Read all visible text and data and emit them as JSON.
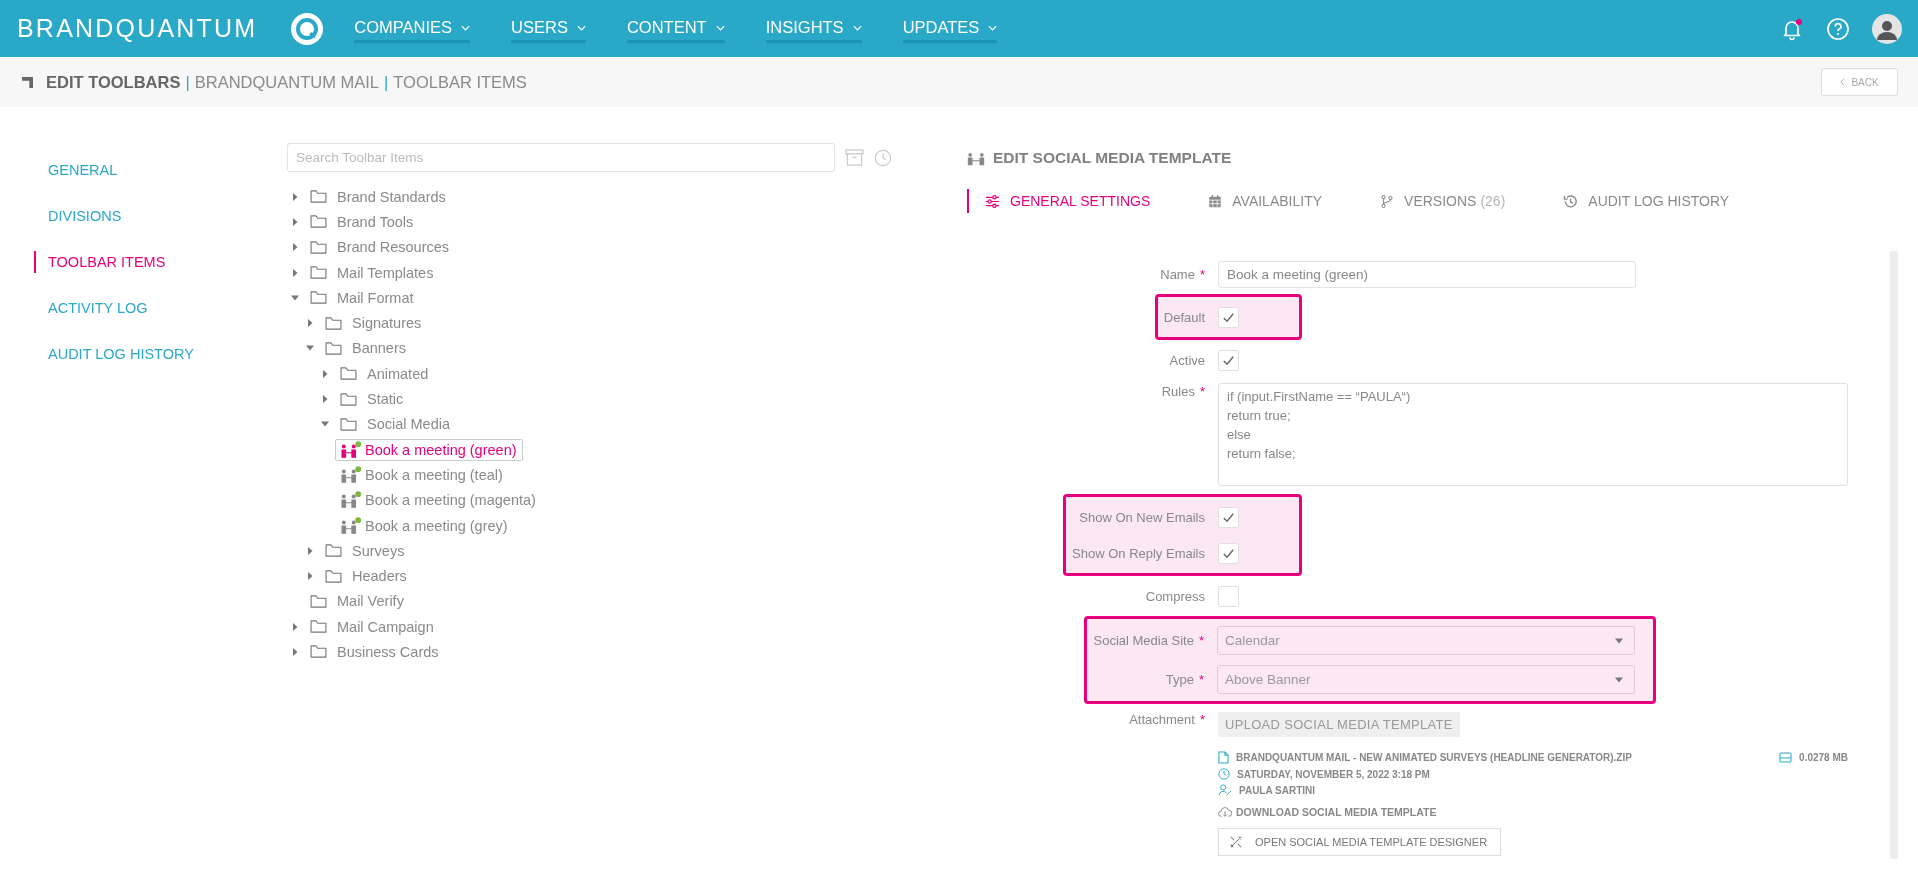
{
  "header": {
    "brand": "BRANDQUANTUM",
    "nav": [
      {
        "label": "COMPANIES"
      },
      {
        "label": "USERS"
      },
      {
        "label": "CONTENT"
      },
      {
        "label": "INSIGHTS"
      },
      {
        "label": "UPDATES"
      }
    ],
    "notifications_unread": true
  },
  "breadcrumb": [
    {
      "kind": "title",
      "text": "EDIT TOOLBARS"
    },
    {
      "kind": "sep",
      "text": "|"
    },
    {
      "kind": "crumb",
      "text": "BRANDQUANTUM MAIL"
    },
    {
      "kind": "sep",
      "text": "|"
    },
    {
      "kind": "crumb",
      "text": "TOOLBAR ITEMS"
    }
  ],
  "back_button": "BACK",
  "sidebar": {
    "items": [
      {
        "label": "GENERAL",
        "selected": false
      },
      {
        "label": "DIVISIONS",
        "selected": false
      },
      {
        "label": "TOOLBAR ITEMS",
        "selected": true
      },
      {
        "label": "ACTIVITY LOG",
        "selected": false
      },
      {
        "label": "AUDIT LOG HISTORY",
        "selected": false
      }
    ]
  },
  "search": {
    "placeholder": "Search Toolbar Items"
  },
  "tree": [
    {
      "kind": "folder",
      "label": "Brand Standards",
      "expanded": false
    },
    {
      "kind": "folder",
      "label": "Brand Tools",
      "expanded": false
    },
    {
      "kind": "folder",
      "label": "Brand Resources",
      "expanded": false
    },
    {
      "kind": "folder",
      "label": "Mail Templates",
      "expanded": false
    },
    {
      "kind": "folder",
      "label": "Mail Format",
      "expanded": true,
      "children": [
        {
          "kind": "folder",
          "label": "Signatures",
          "expanded": false
        },
        {
          "kind": "folder",
          "label": "Banners",
          "expanded": true,
          "children": [
            {
              "kind": "folder",
              "label": "Animated",
              "expanded": false
            },
            {
              "kind": "folder",
              "label": "Static",
              "expanded": false
            },
            {
              "kind": "folder",
              "label": "Social Media",
              "expanded": true,
              "children": [
                {
                  "kind": "item",
                  "label": "Book a meeting (green)",
                  "selected": true
                },
                {
                  "kind": "item",
                  "label": "Book a meeting (teal)",
                  "selected": false
                },
                {
                  "kind": "item",
                  "label": "Book a meeting (magenta)",
                  "selected": false
                },
                {
                  "kind": "item",
                  "label": "Book a meeting (grey)",
                  "selected": false
                }
              ]
            }
          ]
        },
        {
          "kind": "folder",
          "label": "Surveys",
          "expanded": false
        },
        {
          "kind": "folder",
          "label": "Headers",
          "expanded": false
        }
      ]
    },
    {
      "kind": "folder",
      "label": "Mail Verify"
    },
    {
      "kind": "folder",
      "label": "Mail Campaign",
      "expanded": false
    },
    {
      "kind": "folder",
      "label": "Business Cards",
      "expanded": false
    }
  ],
  "editor": {
    "title": "EDIT SOCIAL MEDIA TEMPLATE",
    "tabs": [
      {
        "kind": "settings",
        "label": "GENERAL SETTINGS",
        "selected": true
      },
      {
        "kind": "calendar",
        "label": "AVAILABILITY",
        "selected": false
      },
      {
        "kind": "branch",
        "label": "VERSIONS",
        "count": "(26)",
        "selected": false
      },
      {
        "kind": "history",
        "label": "AUDIT LOG HISTORY",
        "selected": false
      }
    ],
    "groups": [
      {
        "highlighted": false,
        "rows": [
          {
            "kind": "text",
            "label": "Name",
            "mark": "*",
            "value": "Book a meeting (green)"
          }
        ]
      },
      {
        "highlighted": true,
        "rows": [
          {
            "kind": "checkbox",
            "label": "Default",
            "checked": true
          }
        ]
      },
      {
        "highlighted": false,
        "rows": [
          {
            "kind": "checkbox",
            "label": "Active",
            "checked": true
          },
          {
            "kind": "textarea",
            "label": "Rules",
            "mark": "*",
            "lines": [
              "if (input.FirstName == “PAULA“)",
              "return true;",
              "else",
              "return false;"
            ]
          }
        ]
      },
      {
        "highlighted": true,
        "rows": [
          {
            "kind": "checkbox",
            "label": "Show On New Emails",
            "checked": true
          },
          {
            "kind": "checkbox",
            "label": "Show On Reply Emails",
            "checked": true
          }
        ]
      },
      {
        "highlighted": false,
        "rows": [
          {
            "kind": "checkbox",
            "label": "Compress",
            "checked": false
          }
        ]
      },
      {
        "highlighted": true,
        "rows": [
          {
            "kind": "select",
            "label": "Social Media Site",
            "mark": "*",
            "value": "Calendar"
          },
          {
            "kind": "select",
            "label": "Type",
            "mark": "*",
            "value": "Above Banner"
          }
        ]
      },
      {
        "highlighted": false,
        "rows": [
          {
            "kind": "attachment",
            "label": "Attachment",
            "mark": "*",
            "upload_button": "UPLOAD SOCIAL MEDIA TEMPLATE",
            "file_name": "BRANDQUANTUM MAIL - NEW ANIMATED SURVEYS (HEADLINE GENERATOR).ZIP",
            "file_size": "0.0278 MB",
            "date": "SATURDAY, NOVEMBER 5, 2022 3:18 PM",
            "author": "PAULA SARTINI",
            "download_link": "DOWNLOAD SOCIAL MEDIA TEMPLATE",
            "designer_button": "OPEN SOCIAL MEDIA TEMPLATE DESIGNER"
          }
        ]
      }
    ]
  }
}
